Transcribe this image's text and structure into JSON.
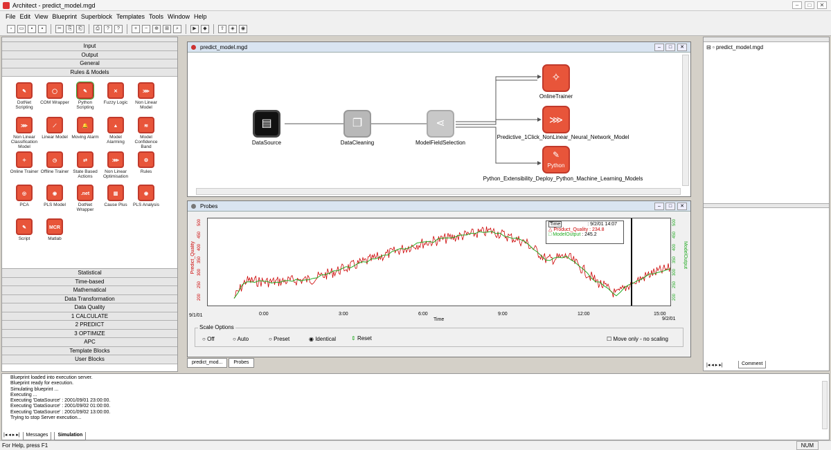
{
  "window": {
    "title": "Architect - predict_model.mgd"
  },
  "menu": [
    "File",
    "Edit",
    "View",
    "Blueprint",
    "Superblock",
    "Templates",
    "Tools",
    "Window",
    "Help"
  ],
  "categories_top": [
    "Input",
    "Output",
    "General",
    "Rules & Models"
  ],
  "palette": [
    {
      "label": "DotNet Scripting",
      "icon": "dotnet-script-icon",
      "glyph": "✎"
    },
    {
      "label": "COM Wrapper",
      "icon": "com-wrapper-icon",
      "glyph": "◯"
    },
    {
      "label": "Python Scripting",
      "icon": "python-script-icon",
      "glyph": "✎"
    },
    {
      "label": "Fuzzy Logic",
      "icon": "fuzzy-logic-icon",
      "glyph": "✕"
    },
    {
      "label": "Non Linear Model",
      "icon": "nonlinear-model-icon",
      "glyph": "⋙"
    },
    {
      "label": "Non Linear Classification Model",
      "icon": "nonlinear-class-icon",
      "glyph": "⋙"
    },
    {
      "label": "Linear Model",
      "icon": "linear-model-icon",
      "glyph": "⟋"
    },
    {
      "label": "Moving Alarm",
      "icon": "moving-alarm-icon",
      "glyph": "🔔"
    },
    {
      "label": "Model Alarming",
      "icon": "model-alarm-icon",
      "glyph": "▲"
    },
    {
      "label": "Model Confidence Band",
      "icon": "confidence-band-icon",
      "glyph": "≋"
    },
    {
      "label": "Online Trainer",
      "icon": "online-trainer-icon",
      "glyph": "✧"
    },
    {
      "label": "Offline Trainer",
      "icon": "offline-trainer-icon",
      "glyph": "◷"
    },
    {
      "label": "State Based Actions",
      "icon": "state-actions-icon",
      "glyph": "⇄"
    },
    {
      "label": "Non Linear Optimisation",
      "icon": "nonlinear-opt-icon",
      "glyph": "⋙"
    },
    {
      "label": "Rules",
      "icon": "rules-icon",
      "glyph": "⚙"
    },
    {
      "label": "PCA",
      "icon": "pca-icon",
      "glyph": "◎"
    },
    {
      "label": "PLS Model",
      "icon": "pls-model-icon",
      "glyph": "◉"
    },
    {
      "label": "DotNet Wrapper",
      "icon": "dotnet-wrapper-icon",
      "glyph": ".net"
    },
    {
      "label": "Cause Plus",
      "icon": "cause-plus-icon",
      "glyph": "▥"
    },
    {
      "label": "PLS Analysis",
      "icon": "pls-analysis-icon",
      "glyph": "◉"
    },
    {
      "label": "Script",
      "icon": "script-icon",
      "glyph": "✎"
    },
    {
      "label": "Matlab",
      "icon": "matlab-icon",
      "glyph": "MCR"
    }
  ],
  "categories_bottom": [
    "Statistical",
    "Time-based",
    "Mathematical",
    "Data Transformation",
    "Data Quality",
    "1 CALCULATE",
    "2 PREDICT",
    "3 OPTIMIZE",
    "APC",
    "Template Blocks",
    "User Blocks"
  ],
  "design": {
    "title": "predict_model.mgd",
    "nodes": {
      "datasource": "DataSource",
      "datacleaning": "DataCleaning",
      "fieldsel": "ModelFieldSelection",
      "trainer": "OnlineTrainer",
      "predictive": "Predictive_1Click_NonLinear_Neural_Network_Model",
      "python": "Python_Extensibility_Deploy_Python_Machine_Learning_Models",
      "python_badge": "Python"
    }
  },
  "probes": {
    "title": "Probes",
    "left_axis": "Predict_Quality",
    "right_axis": "ModelOutput",
    "x_label": "Time",
    "x_ticks": [
      "0:00",
      "3:00",
      "6:00",
      "9:00",
      "12:00",
      "15:00"
    ],
    "x_start": "9/1/01",
    "x_end": "9/2/01",
    "y_ticks_left": [
      "500",
      "450",
      "400",
      "350",
      "300",
      "250",
      "200"
    ],
    "y_ticks_right": [
      "500",
      "450",
      "400",
      "350",
      "300",
      "250",
      "200"
    ],
    "legend": {
      "time_label": "Time",
      "time_value": ": 9/2/01 14:07",
      "s1_name": "Product_Quality",
      "s1_value": ": 234.8",
      "s2_name": "ModelOutput",
      "s2_value": ": 245.2"
    },
    "scale_title": "Scale Options",
    "scale_options": [
      "Off",
      "Auto",
      "Preset",
      "Identical"
    ],
    "reset": "Reset",
    "move_only": "Move only - no scaling",
    "colors": {
      "s1": "#cc0000",
      "s2": "#22aa22"
    }
  },
  "mdi_tabs": [
    "predict_mod...",
    "Probes"
  ],
  "right": {
    "tree_item": "predict_model.mgd",
    "tab": "Comment"
  },
  "output": {
    "lines": [
      "Blueprint loaded into execution server.",
      "Blueprint ready for execution.",
      "Simulating blueprint ...",
      "Executing ...",
      "Executing 'DataSource' : 2001/09/01 23:00:00.",
      "Executing 'DataSource' : 2001/09/02 01:00:00.",
      "Executing 'DataSource' : 2001/09/02 13:00:00.",
      "Trying to stop Server execution..."
    ],
    "tabs": [
      "Messages",
      "Simulation"
    ]
  },
  "status": {
    "help": "For Help, press F1",
    "num": "NUM"
  }
}
